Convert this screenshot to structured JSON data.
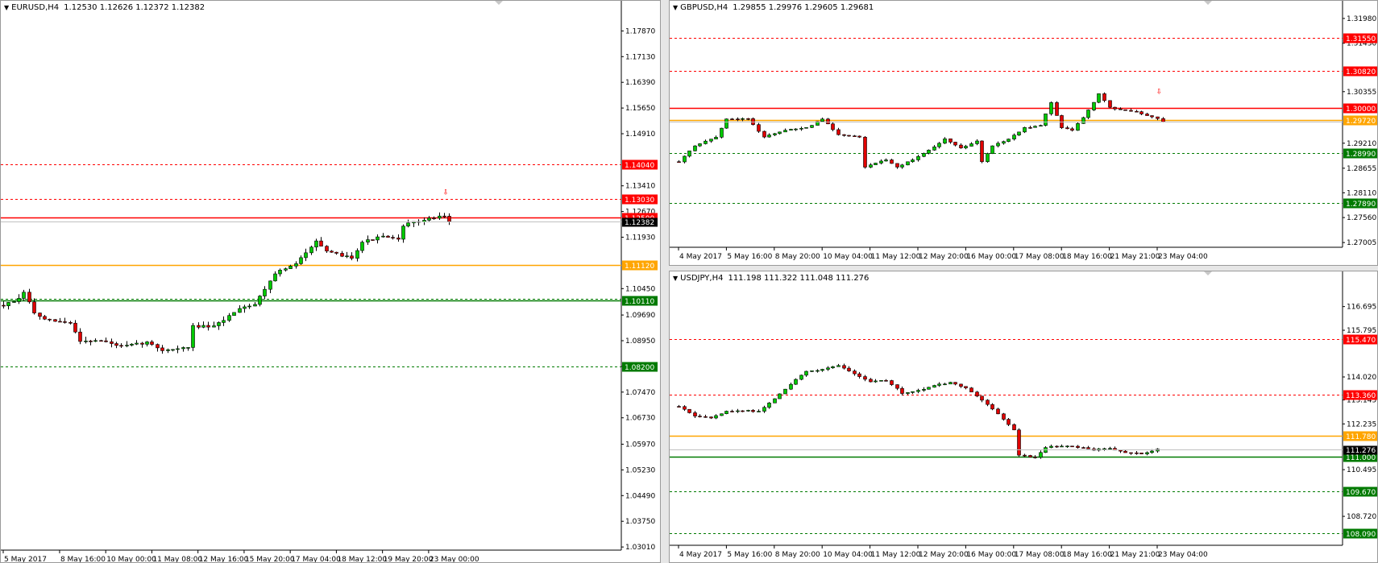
{
  "colors": {
    "bull": "#00c800",
    "bear": "#e00000",
    "wick": "#000000",
    "resistance": "#ff0000",
    "support": "#007a00",
    "pivot": "#ffa500",
    "text": "#000000",
    "axis_line": "#000000"
  },
  "arrow_glyph": "⇩",
  "chart_data": [
    {
      "id": "eurusd",
      "type": "candlestick",
      "symbol": "EURUSD",
      "timeframe": "H4",
      "title": "EURUSD,H4",
      "ohlc_text": "1.12530 1.12626 1.12372 1.12382",
      "ylim": [
        1.0292,
        1.1832
      ],
      "price_ticks": [
        "1.17870",
        "1.17130",
        "1.16390",
        "1.15650",
        "1.14910",
        "1.13410",
        "1.12670",
        "1.11930",
        "1.10450",
        "1.09690",
        "1.08950",
        "1.08210",
        "1.07470",
        "1.06730",
        "1.05970",
        "1.05230",
        "1.04490",
        "1.03750",
        "1.03010"
      ],
      "time_labels": [
        "5 May 2017",
        "8 May 16:00",
        "10 May 00:00",
        "11 May 08:00",
        "12 May 16:00",
        "15 May 20:00",
        "17 May 04:00",
        "18 May 12:00",
        "19 May 20:00",
        "23 May 00:00"
      ],
      "time_label_slots": [
        0,
        11,
        20,
        29,
        38,
        47,
        56,
        65,
        74,
        83
      ],
      "levels": [
        {
          "price": 1.1404,
          "label": "1.14040",
          "color": "resistance",
          "style": "dashed",
          "tag": "resistance"
        },
        {
          "price": 1.1303,
          "label": "1.13030",
          "color": "resistance",
          "style": "dashed",
          "tag": "resistance"
        },
        {
          "price": 1.125,
          "label": "1.12500",
          "color": "resistance",
          "style": "solid",
          "tag": "resistance"
        },
        {
          "price": 1.1112,
          "label": "1.11120",
          "color": "pivot",
          "style": "solid",
          "tag": "pivot"
        },
        {
          "price": 1.1011,
          "label": "1.10110",
          "color": "support",
          "style": "solid",
          "tag": "support"
        },
        {
          "price": 1.1015,
          "label": "",
          "color": "support",
          "style": "dashed",
          "tag": "none"
        },
        {
          "price": 1.082,
          "label": "1.08200",
          "color": "support",
          "style": "dashed",
          "tag": "support"
        }
      ],
      "current_price": 1.12382,
      "current_label": "1.12382",
      "arrow_slot": 87,
      "arrow_price": 1.1335,
      "anchors": [
        [
          0,
          1.0997
        ],
        [
          3,
          1.1014
        ],
        [
          4,
          1.1035
        ],
        [
          6,
          1.0975
        ],
        [
          8,
          1.0955
        ],
        [
          13,
          1.0945
        ],
        [
          15,
          1.0895
        ],
        [
          19,
          1.0895
        ],
        [
          23,
          1.0878
        ],
        [
          28,
          1.089
        ],
        [
          31,
          1.0868
        ],
        [
          36,
          1.0875
        ],
        [
          37,
          1.0937
        ],
        [
          41,
          1.0935
        ],
        [
          43,
          1.0955
        ],
        [
          46,
          1.099
        ],
        [
          49,
          1.1
        ],
        [
          53,
          1.109
        ],
        [
          57,
          1.1115
        ],
        [
          61,
          1.1185
        ],
        [
          63,
          1.115
        ],
        [
          68,
          1.1135
        ],
        [
          70,
          1.118
        ],
        [
          74,
          1.1195
        ],
        [
          77,
          1.1185
        ],
        [
          78,
          1.1228
        ],
        [
          83,
          1.1246
        ],
        [
          86,
          1.1256
        ],
        [
          87,
          1.1238
        ]
      ]
    },
    {
      "id": "gbpusd",
      "type": "candlestick",
      "symbol": "GBPUSD",
      "timeframe": "H4",
      "title": "GBPUSD,H4",
      "ohlc_text": "1.29855 1.29976 1.29605 1.29681",
      "ylim": [
        1.269,
        1.3205
      ],
      "price_ticks": [
        "1.31980",
        "1.31430",
        "1.30355",
        "1.29210",
        "1.28655",
        "1.28110",
        "1.27560",
        "1.27005"
      ],
      "time_labels": [
        "4 May 2017",
        "5 May 16:00",
        "8 May 20:00",
        "10 May 04:00",
        "11 May 12:00",
        "12 May 20:00",
        "16 May 00:00",
        "17 May 08:00",
        "18 May 16:00",
        "21 May 21:00",
        "23 May 04:00"
      ],
      "time_label_slots": [
        0,
        9,
        18,
        27,
        36,
        45,
        54,
        63,
        72,
        81,
        90
      ],
      "levels": [
        {
          "price": 1.3155,
          "label": "1.31550",
          "color": "resistance",
          "style": "dashed",
          "tag": "resistance"
        },
        {
          "price": 1.3082,
          "label": "1.30820",
          "color": "resistance",
          "style": "dashed",
          "tag": "resistance"
        },
        {
          "price": 1.3,
          "label": "1.30000",
          "color": "resistance",
          "style": "solid",
          "tag": "resistance"
        },
        {
          "price": 1.2972,
          "label": "1.29720",
          "color": "pivot",
          "style": "solid",
          "tag": "pivot"
        },
        {
          "price": 1.2899,
          "label": "1.28990",
          "color": "support",
          "style": "dashed",
          "tag": "support"
        },
        {
          "price": 1.2789,
          "label": "1.27890",
          "color": "support",
          "style": "dashed",
          "tag": "support"
        }
      ],
      "current_price": 1.29681,
      "current_label": "",
      "arrow_slot": 91,
      "arrow_price": 1.3045,
      "anchors": [
        [
          0,
          1.288
        ],
        [
          3,
          1.2915
        ],
        [
          7,
          1.2935
        ],
        [
          9,
          1.2975
        ],
        [
          13,
          1.2975
        ],
        [
          16,
          1.2935
        ],
        [
          20,
          1.295
        ],
        [
          24,
          1.2955
        ],
        [
          27,
          1.2975
        ],
        [
          30,
          1.294
        ],
        [
          34,
          1.2935
        ],
        [
          35,
          1.2868
        ],
        [
          39,
          1.2885
        ],
        [
          41,
          1.2868
        ],
        [
          44,
          1.2885
        ],
        [
          47,
          1.2905
        ],
        [
          50,
          1.293
        ],
        [
          53,
          1.291
        ],
        [
          56,
          1.2925
        ],
        [
          57,
          1.288
        ],
        [
          59,
          1.2915
        ],
        [
          62,
          1.293
        ],
        [
          65,
          1.2955
        ],
        [
          68,
          1.296
        ],
        [
          70,
          1.3012
        ],
        [
          72,
          1.2955
        ],
        [
          74,
          1.295
        ],
        [
          76,
          1.2978
        ],
        [
          79,
          1.303
        ],
        [
          81,
          1.3
        ],
        [
          83,
          1.2995
        ],
        [
          86,
          1.299
        ],
        [
          88,
          1.2982
        ],
        [
          90,
          1.2975
        ],
        [
          91,
          1.2968
        ]
      ]
    },
    {
      "id": "usdjpy",
      "type": "candlestick",
      "symbol": "USDJPY",
      "timeframe": "H4",
      "title": "USDJPY,H4",
      "ohlc_text": "111.198 111.322 111.048 111.276",
      "ylim": [
        107.62,
        117.48
      ],
      "price_ticks": [
        "116.695",
        "115.795",
        "114.020",
        "113.145",
        "112.235",
        "110.495",
        "108.720"
      ],
      "time_labels": [
        "4 May 2017",
        "5 May 16:00",
        "8 May 20:00",
        "10 May 04:00",
        "11 May 12:00",
        "12 May 20:00",
        "16 May 00:00",
        "17 May 08:00",
        "18 May 16:00",
        "21 May 21:00",
        "23 May 04:00"
      ],
      "time_label_slots": [
        0,
        9,
        18,
        27,
        36,
        45,
        54,
        63,
        72,
        81,
        90
      ],
      "levels": [
        {
          "price": 115.47,
          "label": "115.470",
          "color": "resistance",
          "style": "dashed",
          "tag": "resistance"
        },
        {
          "price": 113.36,
          "label": "113.360",
          "color": "resistance",
          "style": "dashed",
          "tag": "resistance"
        },
        {
          "price": 111.78,
          "label": "111.780",
          "color": "pivot",
          "style": "solid",
          "tag": "pivot"
        },
        {
          "price": 111.0,
          "label": "111.000",
          "color": "support",
          "style": "solid",
          "tag": "support"
        },
        {
          "price": 109.67,
          "label": "109.670",
          "color": "support",
          "style": "dashed",
          "tag": "support"
        },
        {
          "price": 108.09,
          "label": "108.090",
          "color": "support",
          "style": "dashed",
          "tag": "support"
        }
      ],
      "current_price": 111.276,
      "current_label": "111.276",
      "arrow_slot": -1,
      "arrow_price": 0,
      "anchors": [
        [
          0,
          112.9
        ],
        [
          3,
          112.55
        ],
        [
          6,
          112.45
        ],
        [
          9,
          112.7
        ],
        [
          12,
          112.75
        ],
        [
          15,
          112.7
        ],
        [
          18,
          113.2
        ],
        [
          21,
          113.75
        ],
        [
          24,
          114.25
        ],
        [
          27,
          114.3
        ],
        [
          30,
          114.45
        ],
        [
          33,
          114.15
        ],
        [
          36,
          113.85
        ],
        [
          39,
          113.9
        ],
        [
          42,
          113.4
        ],
        [
          45,
          113.5
        ],
        [
          48,
          113.7
        ],
        [
          51,
          113.8
        ],
        [
          54,
          113.6
        ],
        [
          57,
          113.15
        ],
        [
          60,
          112.6
        ],
        [
          63,
          112.0
        ],
        [
          64,
          111.05
        ],
        [
          67,
          110.95
        ],
        [
          69,
          111.35
        ],
        [
          72,
          111.4
        ],
        [
          75,
          111.35
        ],
        [
          78,
          111.25
        ],
        [
          81,
          111.3
        ],
        [
          84,
          111.15
        ],
        [
          87,
          111.1
        ],
        [
          89,
          111.2
        ],
        [
          90,
          111.276
        ]
      ]
    }
  ]
}
